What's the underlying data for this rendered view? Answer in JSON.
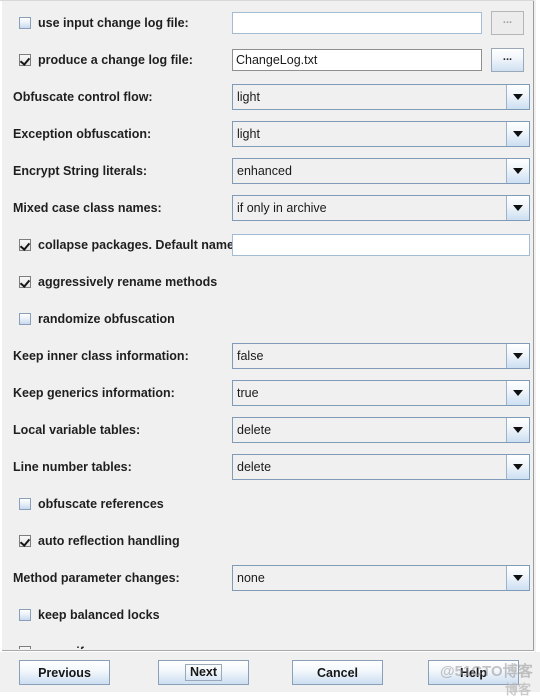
{
  "colors": {
    "background": "#f0f0f0",
    "field_border": "#7f9bb8",
    "text": "#1f1f1f",
    "input_background": "#ffffff"
  },
  "form": {
    "rows": [
      {
        "kind": "checkbox-text",
        "checked": false,
        "label": "use input change log file:",
        "value": "",
        "placeholder": "",
        "button_label": "...",
        "button_disabled": true
      },
      {
        "kind": "checkbox-text",
        "checked": true,
        "label": "produce a change log file:",
        "value": "ChangeLog.txt",
        "placeholder": "",
        "button_label": "...",
        "button_disabled": false
      },
      {
        "kind": "combo",
        "label": "Obfuscate control flow:",
        "value": "light"
      },
      {
        "kind": "combo",
        "label": "Exception obfuscation:",
        "value": "light"
      },
      {
        "kind": "combo",
        "label": "Encrypt String literals:",
        "value": "enhanced"
      },
      {
        "kind": "combo",
        "label": "Mixed case class names:",
        "value": "if only in archive"
      },
      {
        "kind": "checkbox-text-wide",
        "checked": true,
        "label": "collapse packages. Default name:",
        "value": "",
        "placeholder": ""
      },
      {
        "kind": "checkbox",
        "checked": true,
        "label": "aggressively rename methods"
      },
      {
        "kind": "checkbox",
        "checked": false,
        "label": "randomize obfuscation"
      },
      {
        "kind": "combo",
        "label": "Keep inner class information:",
        "value": "false"
      },
      {
        "kind": "combo",
        "label": "Keep generics information:",
        "value": "true"
      },
      {
        "kind": "combo",
        "label": "Local variable tables:",
        "value": "delete"
      },
      {
        "kind": "combo",
        "label": "Line number tables:",
        "value": "delete"
      },
      {
        "kind": "checkbox",
        "checked": false,
        "label": "obfuscate references"
      },
      {
        "kind": "checkbox",
        "checked": true,
        "label": "auto reflection handling"
      },
      {
        "kind": "combo",
        "label": "Method parameter changes:",
        "value": "none"
      },
      {
        "kind": "checkbox",
        "checked": false,
        "label": "keep balanced locks"
      },
      {
        "kind": "checkbox",
        "checked": true,
        "label": "preverify"
      }
    ]
  },
  "buttonbar": {
    "previous": "Previous",
    "next": "Next",
    "cancel": "Cancel",
    "help": "Help"
  },
  "watermark": {
    "text": "@51CTO博客",
    "corner": "博客"
  }
}
